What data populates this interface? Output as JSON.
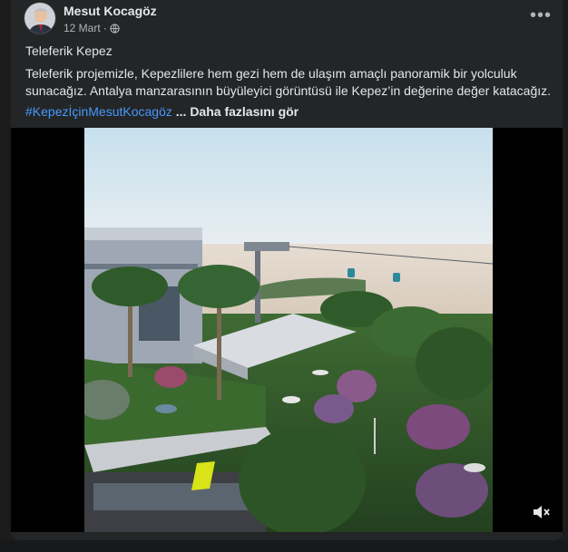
{
  "post": {
    "author": "Mesut Kocagöz",
    "date": "12 Mart",
    "separator": "·",
    "privacy_icon": "globe-icon",
    "more_label": "•••",
    "title": "Teleferik Kepez",
    "body": "Teleferik projemizle, Kepezlilere hem gezi hem de ulaşım amaçlı panoramik bir yolculuk sunacağız. Antalya manzarasının büyüleyici görüntüsü ile Kepez’in değerine değer katacağız.",
    "hashtag": "#KepezİçinMesutKocagöz",
    "see_more": "... Daha fazlasını gör"
  },
  "video": {
    "mute_icon": "speaker-muted-icon"
  },
  "colors": {
    "card_bg": "#242526",
    "hashtag": "#4599ff",
    "text": "#e4e6eb",
    "secondary_text": "#b0b3b8"
  }
}
